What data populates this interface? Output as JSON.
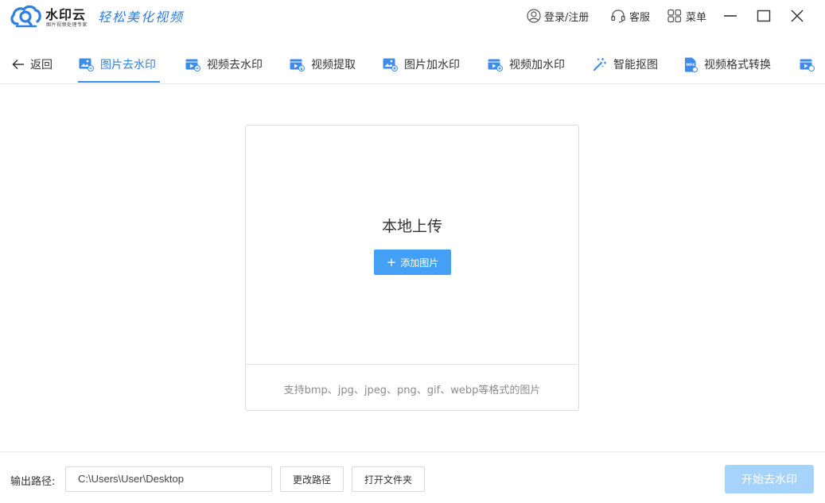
{
  "app": {
    "brand_name": "水印云",
    "brand_sub": "图片视频处理专家",
    "slogan": "轻松美化视频"
  },
  "top_actions": {
    "login": "登录/注册",
    "service": "客服",
    "menu": "菜单"
  },
  "nav": {
    "back": "返回",
    "items": [
      {
        "label": "图片去水印",
        "icon": "image-eraser-icon",
        "active": true
      },
      {
        "label": "视频去水印",
        "icon": "video-eraser-icon"
      },
      {
        "label": "视频提取",
        "icon": "video-extract-icon"
      },
      {
        "label": "图片加水印",
        "icon": "image-add-watermark-icon"
      },
      {
        "label": "视频加水印",
        "icon": "video-add-watermark-icon"
      },
      {
        "label": "智能抠图",
        "icon": "magic-wand-icon"
      },
      {
        "label": "视频格式转换",
        "icon": "mp4-file-icon"
      }
    ]
  },
  "upload": {
    "title": "本地上传",
    "add_button": "添加图片",
    "hint": "支持bmp、jpg、jpeg、png、gif、webp等格式的图片"
  },
  "bottom": {
    "output_label": "输出路径:",
    "output_path": "C:\\Users\\User\\Desktop",
    "change_path": "更改路径",
    "open_folder": "打开文件夹",
    "start": "开始去水印"
  },
  "colors": {
    "accent": "#2f7fe0",
    "button": "#43a0f5",
    "start_disabled": "#a6d3fb"
  }
}
